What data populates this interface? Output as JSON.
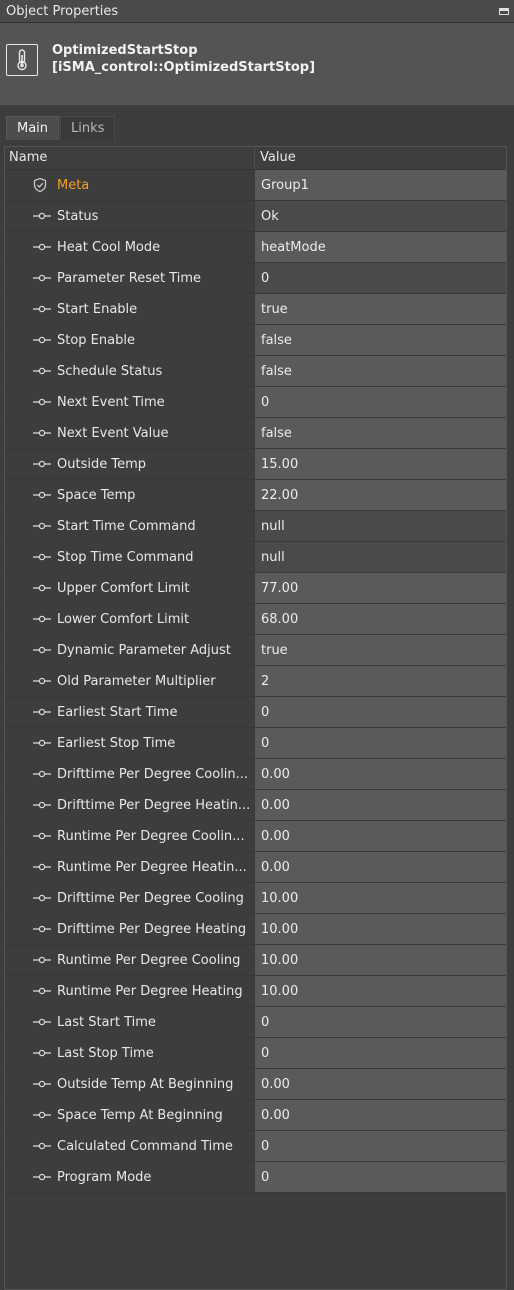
{
  "window": {
    "title": "Object Properties"
  },
  "object": {
    "name": "OptimizedStartStop",
    "type": "[iSMA_control::OptimizedStartStop]"
  },
  "tabs": [
    {
      "label": "Main",
      "active": true
    },
    {
      "label": "Links",
      "active": false
    }
  ],
  "table": {
    "headers": {
      "name": "Name",
      "value": "Value"
    },
    "meta": {
      "name": "Meta",
      "value": "Group1",
      "icon": "shield-check-icon"
    },
    "rows": [
      {
        "name": "Status",
        "value": "Ok",
        "shade": "dark"
      },
      {
        "name": "Heat Cool Mode",
        "value": "heatMode",
        "shade": "light"
      },
      {
        "name": "Parameter Reset Time",
        "value": "0",
        "shade": "dark"
      },
      {
        "name": "Start Enable",
        "value": "true",
        "shade": "light"
      },
      {
        "name": "Stop Enable",
        "value": "false",
        "shade": "light"
      },
      {
        "name": "Schedule Status",
        "value": "false",
        "shade": "light"
      },
      {
        "name": "Next Event Time",
        "value": "0",
        "shade": "light"
      },
      {
        "name": "Next Event Value",
        "value": "false",
        "shade": "light"
      },
      {
        "name": "Outside Temp",
        "value": "15.00",
        "shade": "light"
      },
      {
        "name": "Space Temp",
        "value": "22.00",
        "shade": "light"
      },
      {
        "name": "Start Time Command",
        "value": "null",
        "shade": "dark"
      },
      {
        "name": "Stop Time Command",
        "value": "null",
        "shade": "dark"
      },
      {
        "name": "Upper Comfort Limit",
        "value": "77.00",
        "shade": "light"
      },
      {
        "name": "Lower Comfort Limit",
        "value": "68.00",
        "shade": "light"
      },
      {
        "name": "Dynamic Parameter Adjust",
        "value": "true",
        "shade": "light"
      },
      {
        "name": "Old Parameter Multiplier",
        "value": "2",
        "shade": "light"
      },
      {
        "name": "Earliest Start Time",
        "value": "0",
        "shade": "light"
      },
      {
        "name": "Earliest Stop Time",
        "value": "0",
        "shade": "light"
      },
      {
        "name": "Drifttime Per Degree Coolin...",
        "value": "0.00",
        "shade": "light"
      },
      {
        "name": "Drifttime Per Degree Heatin...",
        "value": "0.00",
        "shade": "light"
      },
      {
        "name": "Runtime Per Degree Coolin...",
        "value": "0.00",
        "shade": "light"
      },
      {
        "name": "Runtime Per Degree Heatin...",
        "value": "0.00",
        "shade": "light"
      },
      {
        "name": "Drifttime Per Degree Cooling",
        "value": "10.00",
        "shade": "light"
      },
      {
        "name": "Drifttime Per Degree Heating",
        "value": "10.00",
        "shade": "light"
      },
      {
        "name": "Runtime Per Degree Cooling",
        "value": "10.00",
        "shade": "light"
      },
      {
        "name": "Runtime Per Degree Heating",
        "value": "10.00",
        "shade": "light"
      },
      {
        "name": "Last Start Time",
        "value": "0",
        "shade": "light"
      },
      {
        "name": "Last Stop Time",
        "value": "0",
        "shade": "light"
      },
      {
        "name": "Outside Temp At Beginning",
        "value": "0.00",
        "shade": "light"
      },
      {
        "name": "Space Temp At Beginning",
        "value": "0.00",
        "shade": "light"
      },
      {
        "name": "Calculated Command Time",
        "value": "0",
        "shade": "light"
      },
      {
        "name": "Program Mode",
        "value": "0",
        "shade": "light"
      }
    ]
  },
  "colors": {
    "meta_label": "#f0a028",
    "value_light": "#5a5a5a",
    "value_dark": "#4a4a4a"
  },
  "icons": {
    "slot": "slot-connector-icon",
    "object": "thermometer-icon",
    "meta": "shield-check-icon",
    "minimize": "minimize-icon"
  }
}
